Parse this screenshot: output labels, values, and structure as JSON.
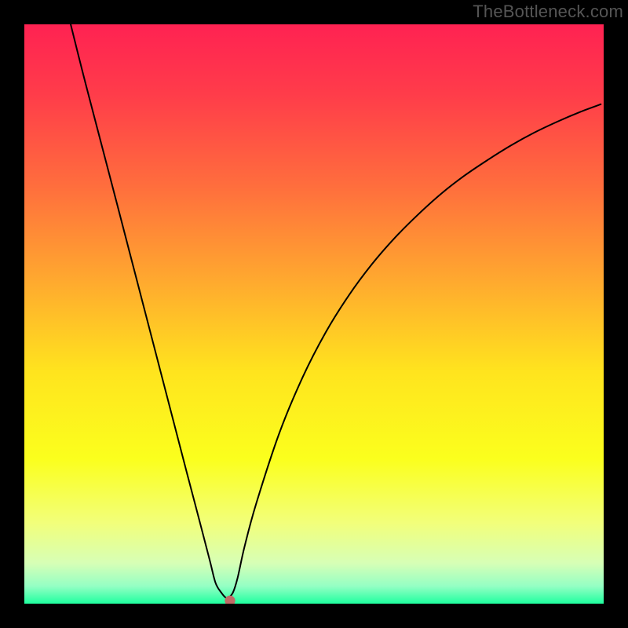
{
  "watermark": "TheBottleneck.com",
  "chart_data": {
    "type": "line",
    "title": "",
    "xlabel": "",
    "ylabel": "",
    "xlim": [
      0,
      100
    ],
    "ylim": [
      0,
      100
    ],
    "grid": false,
    "series": [
      {
        "name": "curve",
        "x": [
          8,
          10,
          12,
          16,
          20,
          24,
          28,
          30,
          32,
          33,
          34,
          34.8,
          35.2,
          36,
          36.8,
          38,
          40,
          44,
          48,
          52,
          56,
          60,
          64,
          68,
          72,
          76,
          80,
          84,
          88,
          92,
          96,
          99.5
        ],
        "y": [
          100,
          92,
          84.3,
          69,
          53.6,
          38.2,
          22.8,
          15.2,
          7.5,
          3.6,
          1.9,
          1.0,
          1.0,
          1.9,
          4.4,
          9.8,
          17.2,
          29.4,
          39,
          46.8,
          53.2,
          58.6,
          63.2,
          67.2,
          70.8,
          73.9,
          76.6,
          79.1,
          81.3,
          83.2,
          84.9,
          86.2
        ]
      }
    ],
    "marker": {
      "x": 35.5,
      "y": 0.5,
      "color": "#c06a66",
      "r": 0.9
    },
    "gradient_stops": [
      {
        "pct": 0,
        "color": "#ff2252"
      },
      {
        "pct": 12,
        "color": "#ff3c4a"
      },
      {
        "pct": 28,
        "color": "#ff6e3d"
      },
      {
        "pct": 44,
        "color": "#ffa82f"
      },
      {
        "pct": 60,
        "color": "#ffe41e"
      },
      {
        "pct": 75,
        "color": "#fbff1d"
      },
      {
        "pct": 86,
        "color": "#f2ff7a"
      },
      {
        "pct": 93,
        "color": "#d7ffb6"
      },
      {
        "pct": 97,
        "color": "#94ffc4"
      },
      {
        "pct": 100,
        "color": "#1fff9f"
      }
    ]
  }
}
